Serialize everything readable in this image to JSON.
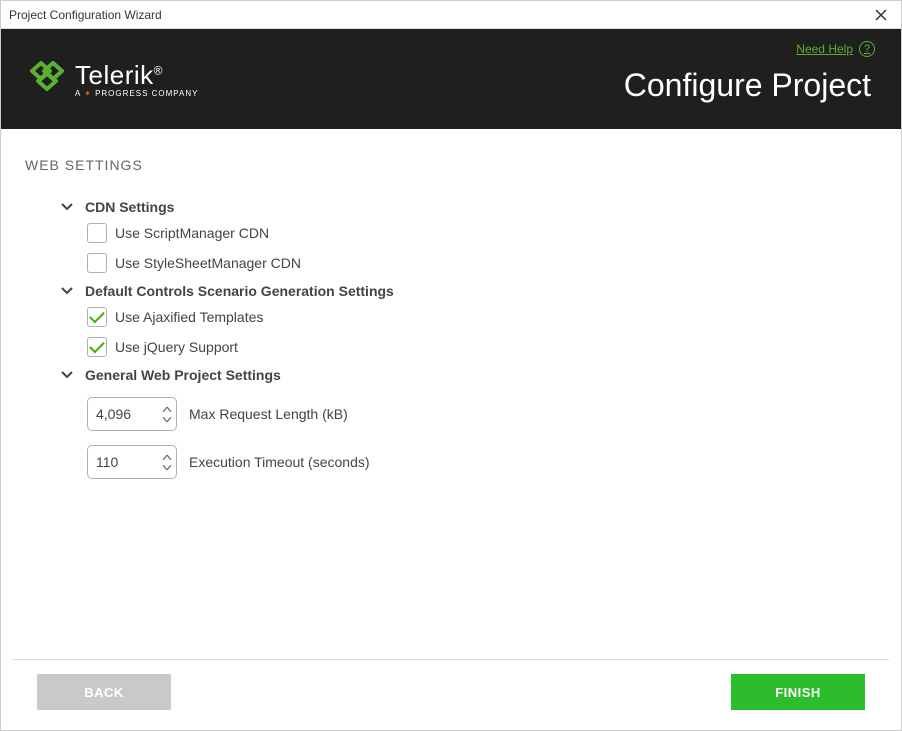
{
  "window": {
    "title": "Project Configuration Wizard"
  },
  "header": {
    "help_label": "Need Help",
    "page_title": "Configure Project",
    "logo_text": "Telerik",
    "logo_tagline": "A PROGRESS COMPANY"
  },
  "main": {
    "section_heading": "WEB SETTINGS",
    "groups": {
      "cdn": {
        "title": "CDN Settings",
        "options": {
          "script_manager": {
            "label": "Use ScriptManager CDN",
            "checked": false
          },
          "stylesheet_manager": {
            "label": "Use StyleSheetManager CDN",
            "checked": false
          }
        }
      },
      "default_controls": {
        "title": "Default Controls Scenario Generation Settings",
        "options": {
          "ajaxified_templates": {
            "label": "Use Ajaxified Templates",
            "checked": true
          },
          "jquery_support": {
            "label": "Use jQuery Support",
            "checked": true
          }
        }
      },
      "general": {
        "title": "General Web Project Settings",
        "max_request_length": {
          "value": "4,096",
          "label": "Max Request Length (kB)"
        },
        "execution_timeout": {
          "value": "110",
          "label": "Execution Timeout (seconds)"
        }
      }
    }
  },
  "footer": {
    "back_label": "BACK",
    "finish_label": "FINISH"
  }
}
